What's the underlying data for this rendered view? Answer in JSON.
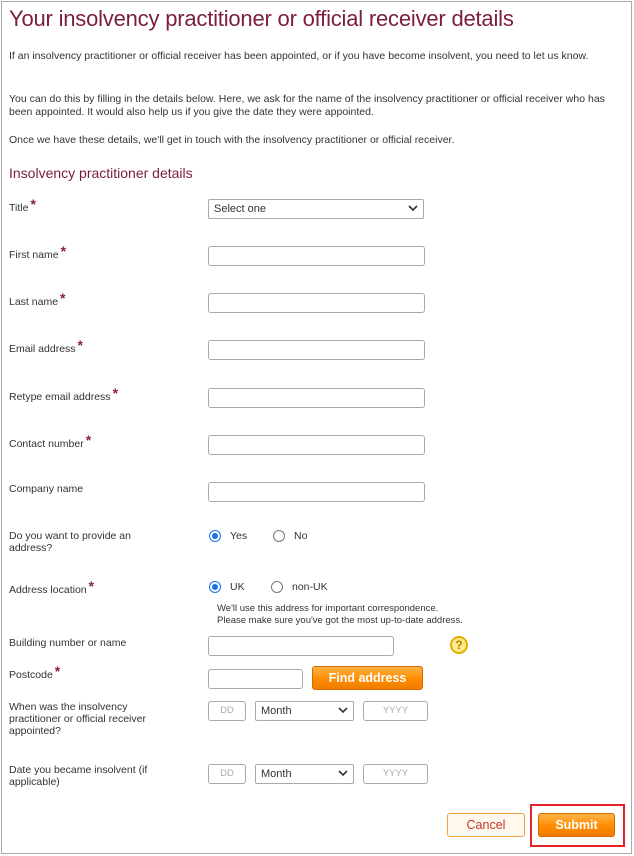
{
  "page": {
    "title": "Your insolvency practitioner or official receiver details",
    "intro": [
      "If an insolvency practitioner or official receiver has been appointed, or if you have become insolvent, you need to let us know.",
      "You can do this by filling in the details below. Here, we ask for the name of the insolvency practitioner or official receiver who has been appointed. It would also help us if you give the date they were appointed.",
      "Once we have these details, we'll get in touch with the insolvency practitioner or official receiver."
    ],
    "section_heading": "Insolvency practitioner details"
  },
  "form": {
    "required_marker": "*",
    "title": {
      "label": "Title",
      "value": "Select one"
    },
    "first_name": {
      "label": "First name",
      "value": ""
    },
    "last_name": {
      "label": "Last name",
      "value": ""
    },
    "email": {
      "label": "Email address",
      "value": ""
    },
    "retype_email": {
      "label": "Retype email address",
      "value": ""
    },
    "contact_number": {
      "label": "Contact number",
      "value": ""
    },
    "company_name": {
      "label": "Company name",
      "value": ""
    },
    "provide_address": {
      "label": "Do you want to provide an address?",
      "options": [
        "Yes",
        "No"
      ],
      "selected": "Yes"
    },
    "address_location": {
      "label": "Address location",
      "options": [
        "UK",
        "non-UK"
      ],
      "selected": "UK",
      "note_line1": "We'll use this address for important correspondence.",
      "note_line2": "Please make sure you've got the most up-to-date address."
    },
    "building": {
      "label": "Building number or name",
      "value": ""
    },
    "postcode": {
      "label": "Postcode",
      "value": ""
    },
    "find_address_label": "Find address",
    "help_icon_glyph": "?",
    "date_appointed": {
      "label": "When was the insolvency practitioner or official receiver appointed?",
      "day_placeholder": "DD",
      "month_value": "Month",
      "year_placeholder": "YYYY"
    },
    "date_insolvent": {
      "label": "Date you became insolvent (if applicable)",
      "day_placeholder": "DD",
      "month_value": "Month",
      "year_placeholder": "YYYY"
    }
  },
  "actions": {
    "cancel_label": "Cancel",
    "submit_label": "Submit"
  },
  "colors": {
    "title": "#7a1e3c",
    "accent_orange": "#ff8c00",
    "radio_selected": "#1a73e8",
    "highlight": "#e8202a"
  }
}
